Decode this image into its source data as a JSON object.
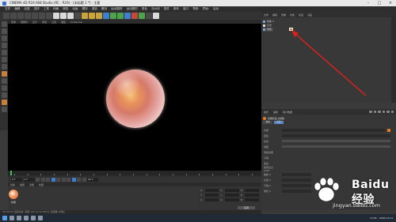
{
  "window": {
    "title": "CINEMA 4D R19.068 Studio (RC - R19) - [未标题 1 *] - 主要"
  },
  "menu": {
    "items": [
      "文件",
      "编辑",
      "创建",
      "选择",
      "工具",
      "网格",
      "捕捉",
      "动画",
      "模拟",
      "渲染",
      "雕刻",
      "运动跟踪",
      "运动图形",
      "角色",
      "流水线",
      "插件",
      "脚本",
      "窗口",
      "帮助",
      "界面:",
      "启动"
    ]
  },
  "viewport_menu": {
    "items": [
      "查看",
      "摄像机",
      "显示",
      "选项",
      "过滤",
      "面板",
      "ProRender"
    ]
  },
  "timeline": {
    "start_frame": "0 F",
    "end_frame": "90 F",
    "current_frame": "0 F",
    "ticks": [
      "0",
      "5",
      "10",
      "15",
      "20",
      "25",
      "30",
      "35",
      "40",
      "45",
      "50",
      "55",
      "60",
      "65",
      "70",
      "75",
      "80",
      "85",
      "90"
    ]
  },
  "materials": {
    "menu": [
      "创建",
      "编辑",
      "功能",
      "纹理"
    ],
    "items": [
      {
        "label": "材质"
      }
    ]
  },
  "coords": {
    "rows": [
      {
        "a": "X",
        "b": "0 cm",
        "c": "X",
        "d": "0 cm",
        "e": "H",
        "f": "0°"
      },
      {
        "a": "Y",
        "b": "0 cm",
        "c": "Y",
        "d": "0 cm",
        "e": "P",
        "f": "0°"
      },
      {
        "a": "Z",
        "b": "0 cm",
        "c": "Z",
        "d": "0 cm",
        "e": "B",
        "f": "0°"
      }
    ],
    "apply_label": "应用"
  },
  "status": {
    "text": "00:00:00 渲染完成: 使用: 04-11 12:58:01 渲染器 (标准)"
  },
  "object_manager": {
    "menu": [
      "文件",
      "编辑",
      "查看",
      "对象",
      "标签",
      "书签"
    ],
    "rows": [
      {
        "label": "球体.1",
        "selected": false
      },
      {
        "label": "灯光",
        "selected": false
      },
      {
        "label": "球体",
        "selected": true
      }
    ]
  },
  "attributes": {
    "menu": [
      "模式",
      "编辑",
      "用户数据"
    ],
    "material_title": "材质标签 [材质]",
    "tabs": [
      {
        "label": "基本",
        "active": false
      },
      {
        "label": "标签",
        "active": true
      }
    ],
    "rows": [
      {
        "label": "材质",
        "value": "材质"
      },
      {
        "label": "选集",
        "value": ""
      },
      {
        "label": "投射",
        "value": "UVW 贴图"
      },
      {
        "label": "侧面",
        "value": "双面"
      },
      {
        "label": "添加材质",
        "value": ""
      },
      {
        "label": "平铺",
        "value": ""
      },
      {
        "label": "连续",
        "value": ""
      },
      {
        "label": "使用凹凸 UVW",
        "value": ""
      },
      {
        "label": "偏移 U",
        "value": "0 %"
      },
      {
        "label": "偏移 V",
        "value": "0 %"
      },
      {
        "label": "长度 U",
        "value": "100 %"
      },
      {
        "label": "长度 V",
        "value": "100 %"
      },
      {
        "label": "平铺 U",
        "value": "1"
      },
      {
        "label": "平铺 V",
        "value": "1"
      },
      {
        "label": "重复 U",
        "value": "0"
      },
      {
        "label": "重复 V",
        "value": "0"
      }
    ]
  },
  "watermark": {
    "brand": "Baidu经验",
    "url": "jingyan.baidu.com"
  },
  "taskbar": {
    "time": "13:05",
    "date": "2020/11/14"
  },
  "colors": {
    "accent_orange": "#e07a2a",
    "selection_blue": "#5b86c2",
    "arrow_red": "#e0201b",
    "viewport_bg": "#000000"
  }
}
